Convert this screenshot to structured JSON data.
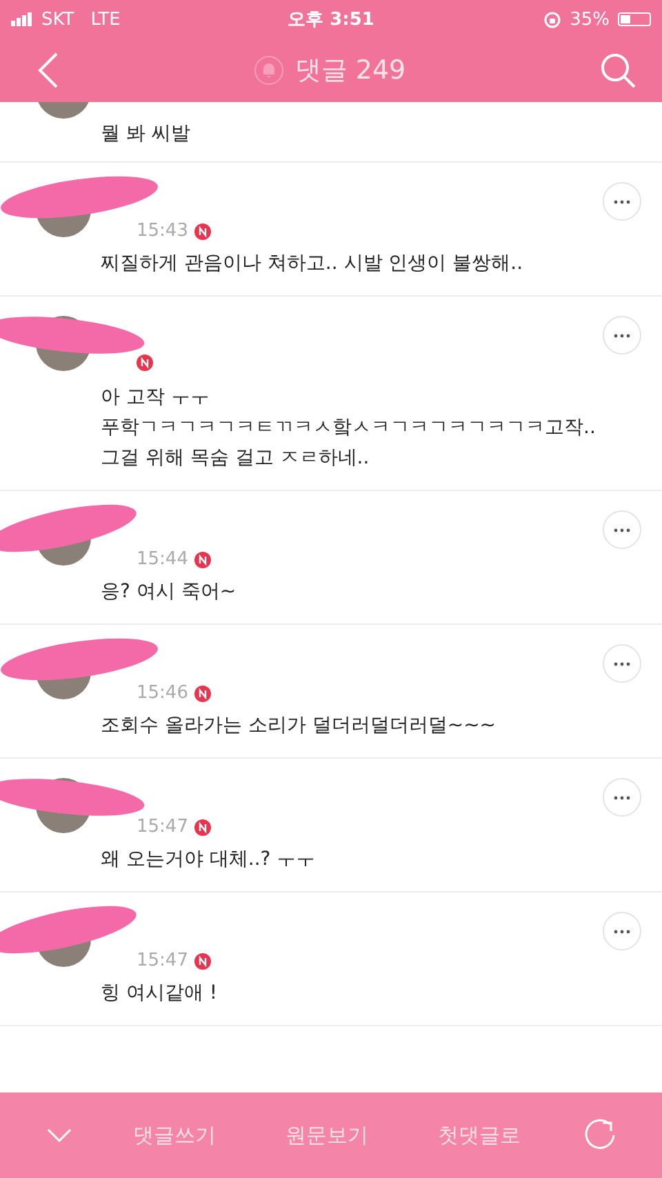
{
  "status_bar": {
    "carrier": "SKT",
    "network": "LTE",
    "time": "오후 3:51",
    "battery": "35%"
  },
  "header": {
    "title": "댓글 249"
  },
  "comments": [
    {
      "kind": "partial",
      "text": [
        "뭘 봐 씨발"
      ]
    },
    {
      "kind": "full",
      "time": "15:43",
      "is_new": true,
      "redacted": true,
      "text": [
        "찌질하게 관음이나 쳐하고.. 시발 인생이 불쌍해.."
      ]
    },
    {
      "kind": "full",
      "is_new": true,
      "redacted": true,
      "text": [
        "아 고작 ㅜㅜ",
        "푸학ㄱㅋㄱㅋㄱㅋㅌㄲㅋㅅ핰ㅅㅋㄱㅋㄱㅋㄱㅋㄱㅋ고작..",
        "그걸 위해 목숨 걸고 ㅈㄹ하네.."
      ]
    },
    {
      "kind": "full",
      "time": "15:44",
      "is_new": true,
      "redacted": true,
      "text": [
        "응? 여시 죽어~"
      ]
    },
    {
      "kind": "full",
      "time": "15:46",
      "is_new": true,
      "redacted": true,
      "text": [
        "조회수 올라가는 소리가 덜더러덜더러덜~~~"
      ]
    },
    {
      "kind": "full",
      "time": "15:47",
      "is_new": true,
      "redacted": true,
      "text": [
        "왜 오는거야 대체..? ㅜㅜ"
      ]
    },
    {
      "kind": "full",
      "time": "15:47",
      "is_new": true,
      "redacted": true,
      "text": [
        "힝 여시같애 !"
      ]
    }
  ],
  "bottom_bar": {
    "buttons": [
      "댓글쓰기",
      "원문보기",
      "첫댓글로"
    ]
  }
}
